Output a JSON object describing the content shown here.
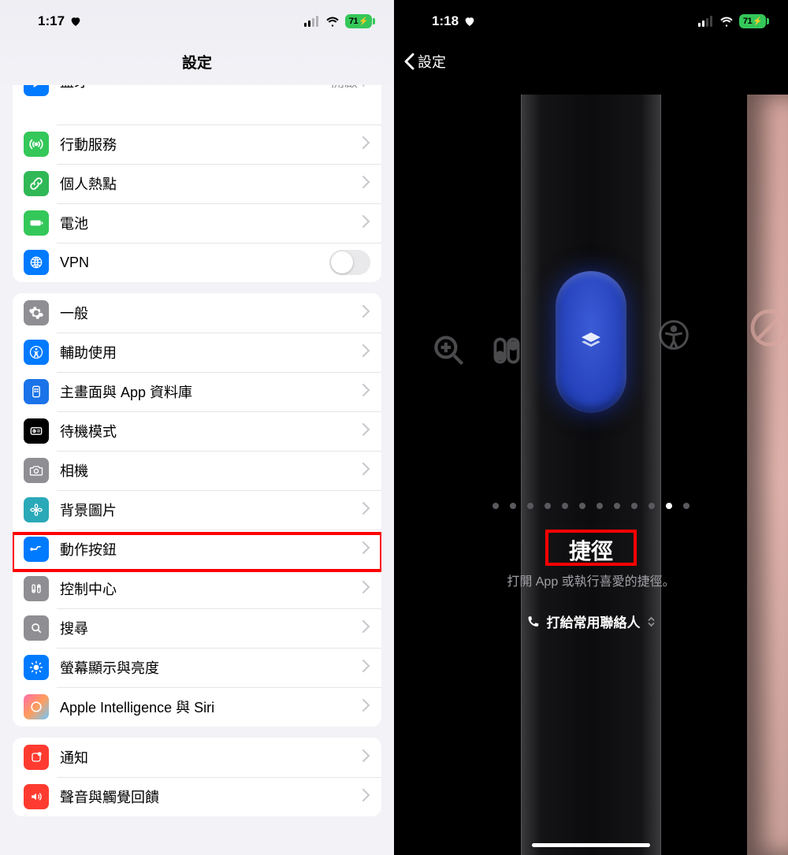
{
  "left": {
    "status": {
      "time": "1:17",
      "battery": "71"
    },
    "title": "設定",
    "truncated_row": {
      "label": "藍牙",
      "value": "開啟"
    },
    "group1": [
      {
        "icon": "antenna-icon",
        "label": "行動服務",
        "bg": "bg-green"
      },
      {
        "icon": "link-icon",
        "label": "個人熱點",
        "bg": "bg-green2"
      },
      {
        "icon": "battery-icon",
        "label": "電池",
        "bg": "bg-green"
      },
      {
        "icon": "globe-icon",
        "label": "VPN",
        "bg": "bg-blue",
        "toggle": true
      }
    ],
    "group2": [
      {
        "icon": "gear-icon",
        "label": "一般",
        "bg": "bg-gray"
      },
      {
        "icon": "accessibility-icon",
        "label": "輔助使用",
        "bg": "bg-blue"
      },
      {
        "icon": "home-apps-icon",
        "label": "主畫面與 App 資料庫",
        "bg": "bg-indigo"
      },
      {
        "icon": "standby-icon",
        "label": "待機模式",
        "bg": "bg-black"
      },
      {
        "icon": "camera-icon",
        "label": "相機",
        "bg": "bg-gray"
      },
      {
        "icon": "flower-icon",
        "label": "背景圖片",
        "bg": "bg-teal"
      },
      {
        "icon": "action-button-icon",
        "label": "動作按鈕",
        "bg": "bg-blue",
        "highlight": true
      },
      {
        "icon": "sliders-icon",
        "label": "控制中心",
        "bg": "bg-gray"
      },
      {
        "icon": "search-icon",
        "label": "搜尋",
        "bg": "bg-gray"
      },
      {
        "icon": "brightness-icon",
        "label": "螢幕顯示與亮度",
        "bg": "bg-blue"
      },
      {
        "icon": "siri-icon",
        "label": "Apple Intelligence 與 Siri",
        "bg": "bg-siri"
      }
    ],
    "group3": [
      {
        "icon": "bell-icon",
        "label": "通知",
        "bg": "bg-red"
      },
      {
        "icon": "sound-icon",
        "label": "聲音與觸覺回饋",
        "bg": "bg-red"
      }
    ]
  },
  "right": {
    "status": {
      "time": "1:18",
      "battery": "71"
    },
    "back_label": "設定",
    "action_name": "捷徑",
    "action_desc": "打開 App 或執行喜愛的捷徑。",
    "selected_shortcut": "打給常用聯絡人",
    "pagination": {
      "count": 12,
      "active_index": 10
    }
  }
}
